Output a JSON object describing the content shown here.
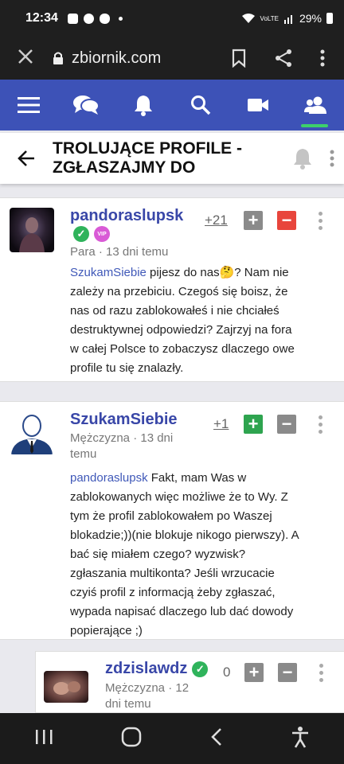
{
  "status": {
    "time": "12:34",
    "network": "VoLTE",
    "battery": "29%"
  },
  "browser": {
    "url": "zbiornik.com"
  },
  "thread": {
    "title_line1": "TROLUJĄCE PROFILE -",
    "title_line2": "ZGŁASZAJMY DO"
  },
  "posts": [
    {
      "username": "pandoraslupsk",
      "vip_label": "VIP",
      "meta_line1": "Para · 13 dni temu",
      "score": "+21",
      "mention": "SzukamSiebie",
      "text_lines": [
        " pijesz do nas🤔? Nam nie",
        "zależy na przebiciu. Czegoś się boisz, że",
        "nas od razu zablokowałeś i nie chciałeś",
        "destruktywnej odpowiedzi? Zajrzyj na fora",
        "w całej Polsce to zobaczysz dlaczego owe",
        "profile tu się znalazły."
      ]
    },
    {
      "username": "SzukamSiebie",
      "meta_line1": "Mężczyzna · 13 dni",
      "meta_line2": "temu",
      "score": "+1",
      "mention": "pandoraslupsk",
      "text_lines": [
        " Fakt, mam Was w",
        "zablokowanych więc możliwe że to Wy. Z",
        "tym że profil zablokowałem po Waszej",
        "blokadzie;))(nie blokuje nikogo pierwszy). A",
        "bać się miałem czego? wyzwisk?",
        "zgłaszania multikonta? Jeśli wrzucacie",
        "czyiś profil z informacją żeby zgłaszać,",
        "wypada napisać dlaczego lub dać dowody",
        "popierające ;)"
      ]
    },
    {
      "username": "zdzislawdz",
      "meta_line1": "Mężczyzna · 12",
      "meta_line2": "dni temu",
      "score": "0"
    }
  ]
}
